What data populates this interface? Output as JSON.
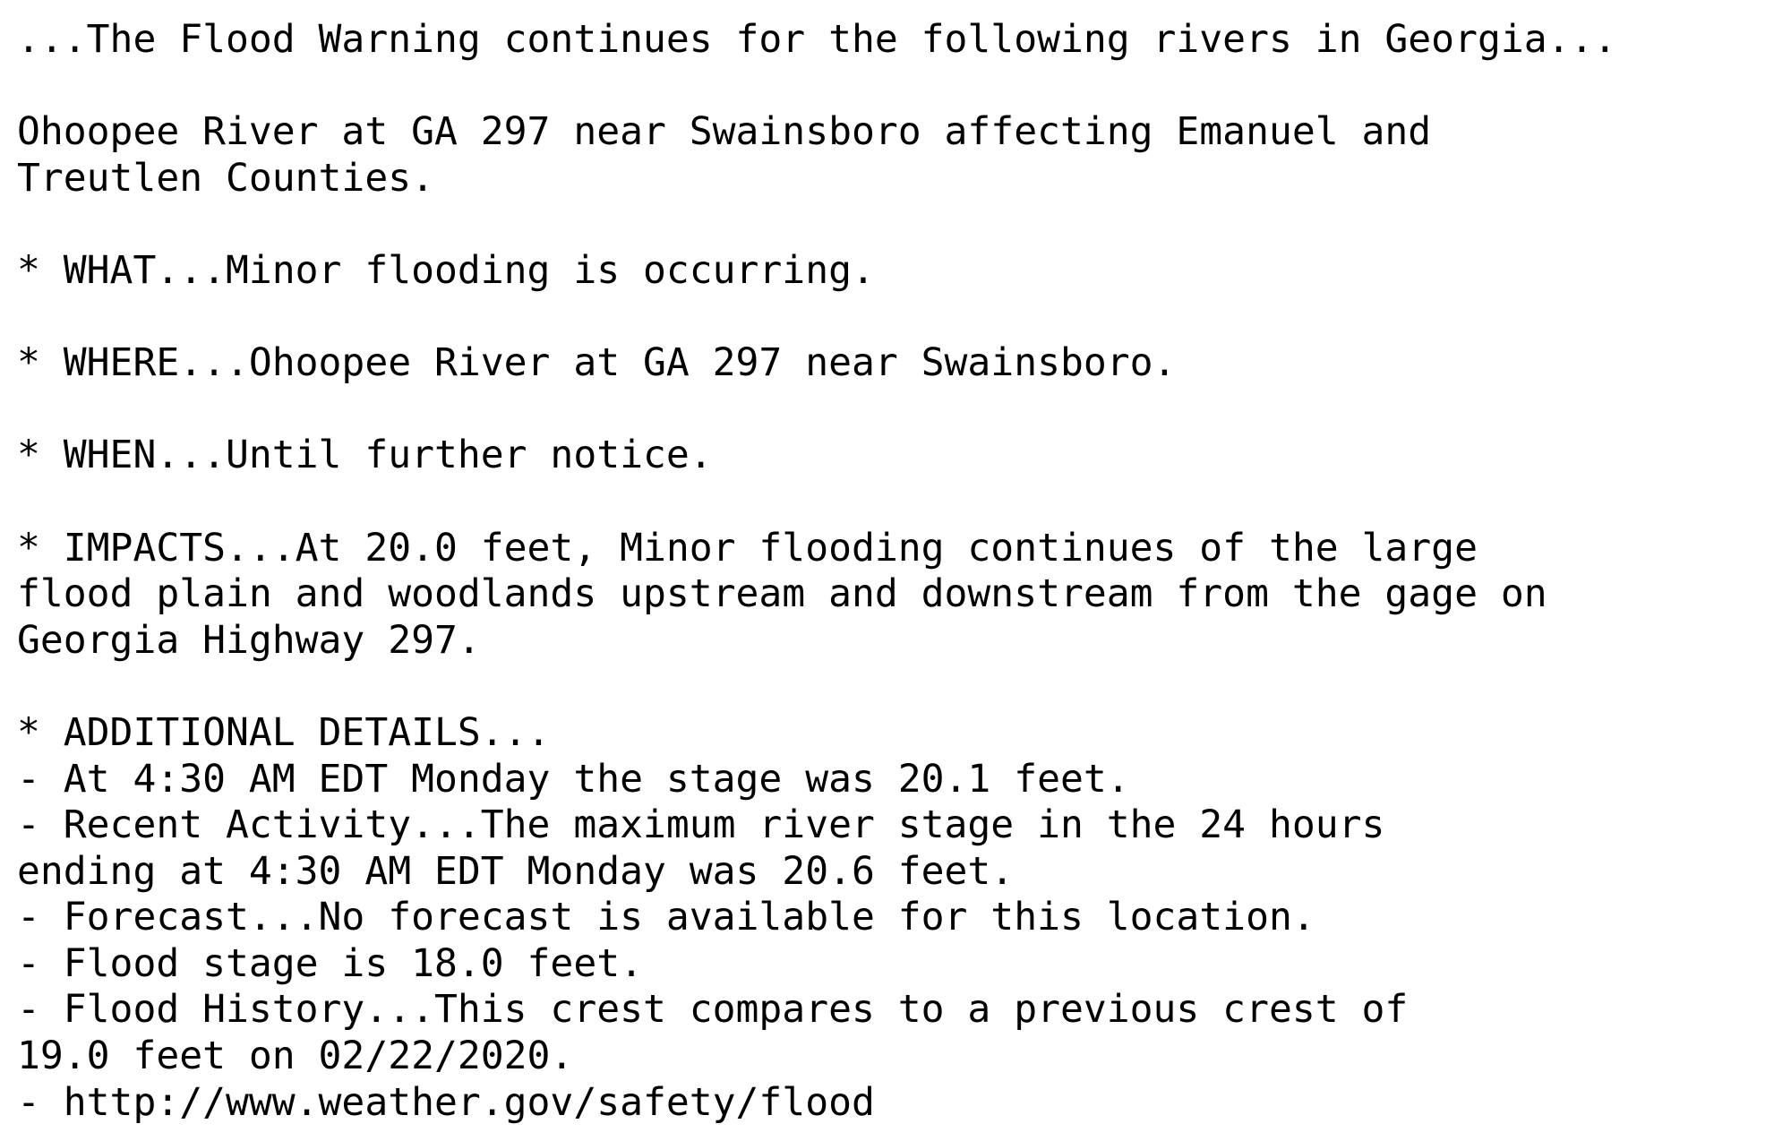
{
  "lines": [
    "...The Flood Warning continues for the following rivers in Georgia...",
    "",
    "Ohoopee River at GA 297 near Swainsboro affecting Emanuel and",
    "Treutlen Counties.",
    "",
    "* WHAT...Minor flooding is occurring.",
    "",
    "* WHERE...Ohoopee River at GA 297 near Swainsboro.",
    "",
    "* WHEN...Until further notice.",
    "",
    "* IMPACTS...At 20.0 feet, Minor flooding continues of the large",
    "flood plain and woodlands upstream and downstream from the gage on",
    "Georgia Highway 297.",
    "",
    "* ADDITIONAL DETAILS...",
    "- At 4:30 AM EDT Monday the stage was 20.1 feet.",
    "- Recent Activity...The maximum river stage in the 24 hours",
    "ending at 4:30 AM EDT Monday was 20.6 feet.",
    "- Forecast...No forecast is available for this location.",
    "- Flood stage is 18.0 feet.",
    "- Flood History...This crest compares to a previous crest of",
    "19.0 feet on 02/22/2020.",
    "- http://www.weather.gov/safety/flood"
  ]
}
